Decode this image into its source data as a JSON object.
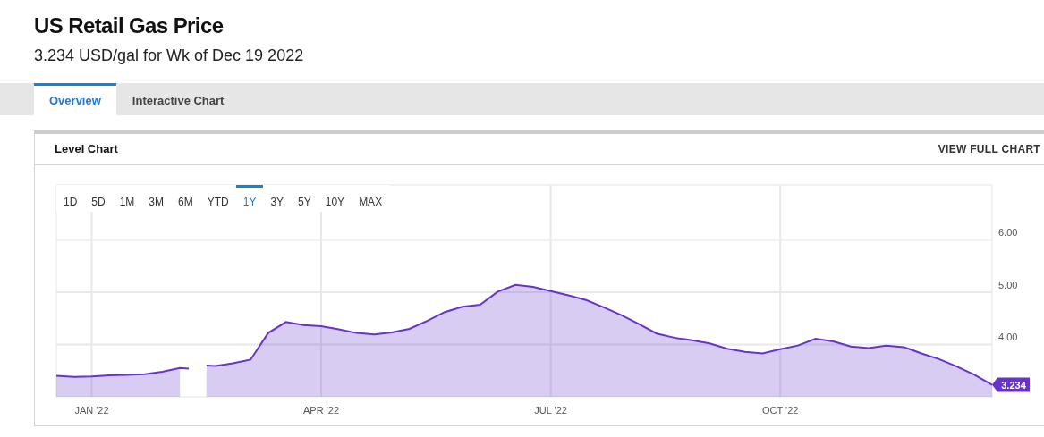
{
  "header": {
    "title": "US Retail Gas Price",
    "subtitle": "3.234 USD/gal for Wk of Dec 19 2022"
  },
  "tabs": [
    {
      "label": "Overview",
      "selected": true
    },
    {
      "label": "Interactive Chart",
      "selected": false
    }
  ],
  "card": {
    "title": "Level Chart",
    "link": "VIEW FULL CHART",
    "ranges": [
      {
        "label": "1D",
        "selected": false
      },
      {
        "label": "5D",
        "selected": false
      },
      {
        "label": "1M",
        "selected": false
      },
      {
        "label": "3M",
        "selected": false
      },
      {
        "label": "6M",
        "selected": false
      },
      {
        "label": "YTD",
        "selected": false
      },
      {
        "label": "1Y",
        "selected": true
      },
      {
        "label": "3Y",
        "selected": false
      },
      {
        "label": "5Y",
        "selected": false
      },
      {
        "label": "10Y",
        "selected": false
      },
      {
        "label": "MAX",
        "selected": false
      }
    ],
    "last_value_badge": "3.234",
    "chart_data": {
      "type": "area",
      "categories": [
        null,
        null,
        "JAN '22",
        null,
        null,
        null,
        null,
        null,
        null,
        null,
        null,
        null,
        null,
        null,
        null,
        "APR '22",
        null,
        null,
        null,
        null,
        null,
        null,
        null,
        null,
        null,
        null,
        null,
        null,
        "JUL '22",
        null,
        null,
        null,
        null,
        null,
        null,
        null,
        null,
        null,
        null,
        null,
        null,
        "OCT '22",
        null,
        null,
        null,
        null,
        null,
        null,
        null,
        null,
        null,
        null,
        null,
        null
      ],
      "series": [
        {
          "color": "#6633cc",
          "values": [
            3.4,
            3.38,
            3.39,
            3.41,
            3.42,
            3.43,
            3.48,
            3.55,
            null,
            3.59,
            3.64,
            3.71,
            4.22,
            4.43,
            4.37,
            4.35,
            4.29,
            4.22,
            4.19,
            4.23,
            4.3,
            4.45,
            4.62,
            4.72,
            4.76,
            5.01,
            5.14,
            5.1,
            5.02,
            4.94,
            4.85,
            4.71,
            4.56,
            4.39,
            4.21,
            4.13,
            4.08,
            4.02,
            3.92,
            3.86,
            3.83,
            3.91,
            3.98,
            4.11,
            4.06,
            3.96,
            3.93,
            3.98,
            3.95,
            3.83,
            3.72,
            3.58,
            3.42,
            3.23
          ]
        }
      ],
      "ylim": [
        3,
        7.05
      ],
      "grid": true,
      "yticks": [
        {
          "value": 4,
          "label": "4.00"
        },
        {
          "value": 5,
          "label": "5.00"
        },
        {
          "value": 6,
          "label": "6.00"
        }
      ]
    }
  }
}
